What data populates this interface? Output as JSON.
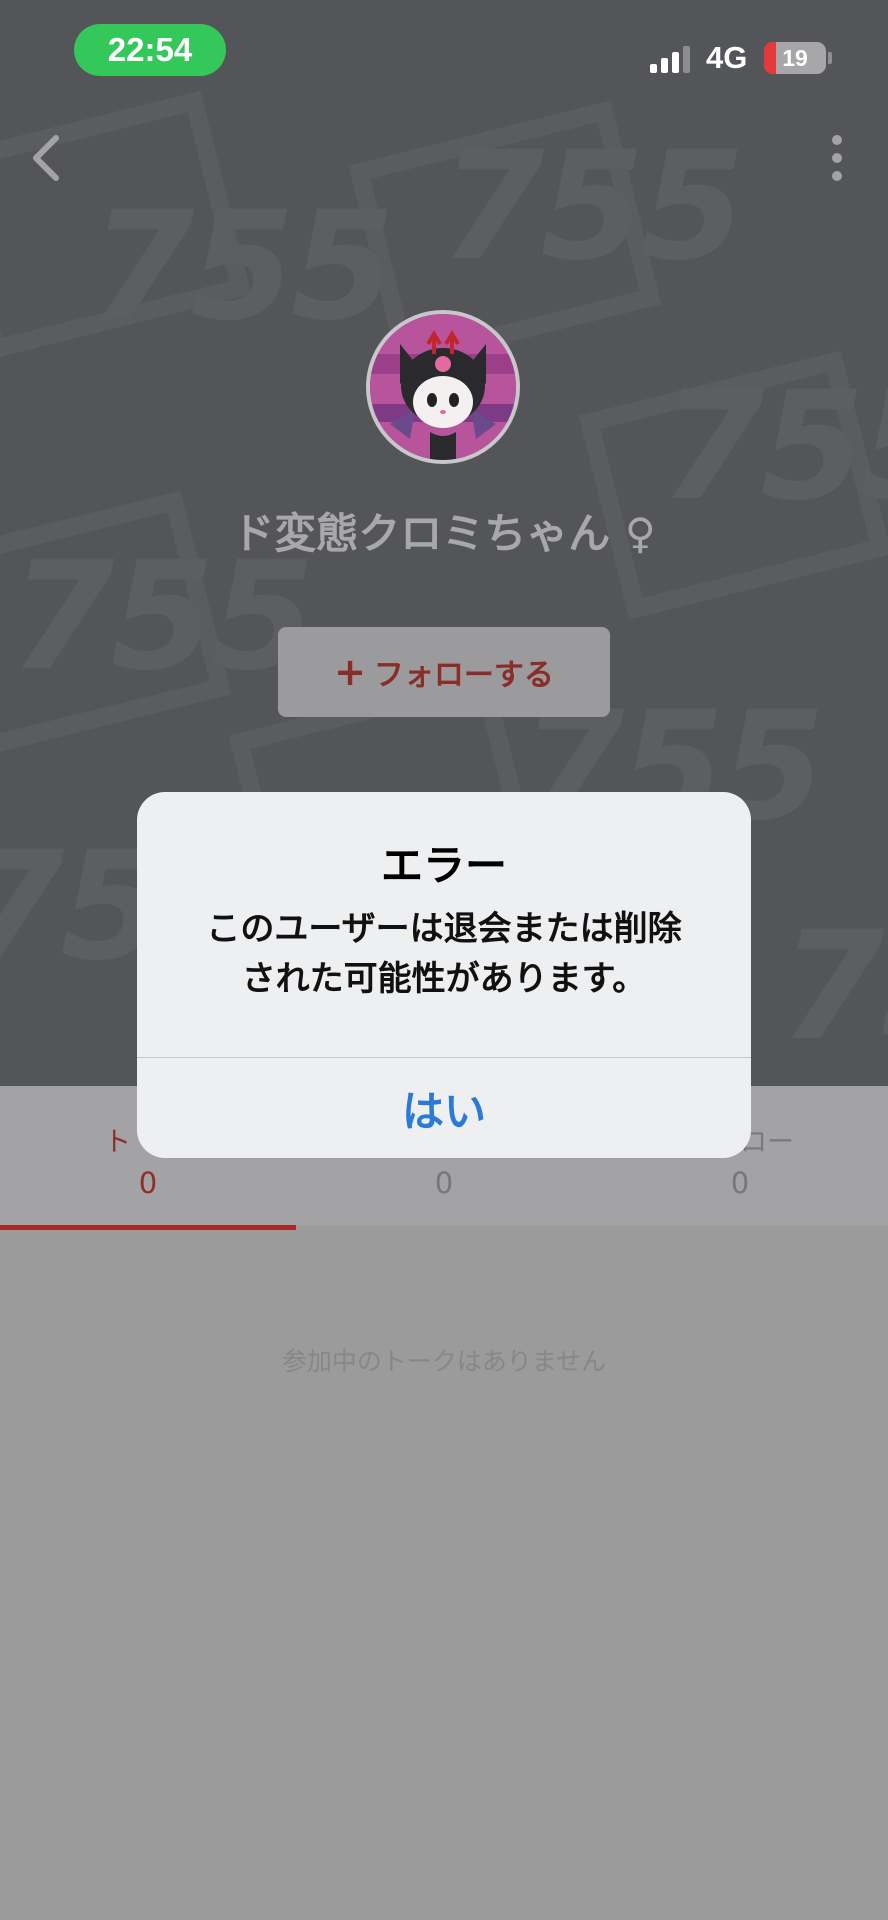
{
  "status_bar": {
    "time": "22:54",
    "network": "4G",
    "battery_level": "19",
    "colors": {
      "time_pill": "#34c759",
      "battery_low": "#e5383b"
    }
  },
  "nav": {
    "back_icon": "chevron-left-icon",
    "more_icon": "vertical-ellipsis-icon"
  },
  "profile": {
    "background_watermark": "755",
    "avatar_icon": "kuromi-avatar",
    "name": "ド変態クロミちゃん ♀",
    "follow_plus": "+",
    "follow_label": "フォローする"
  },
  "tabs": [
    {
      "label": "ト",
      "count": "0",
      "active": true
    },
    {
      "label": "",
      "count": "0",
      "active": false
    },
    {
      "label": "ロー",
      "count": "0",
      "active": false
    }
  ],
  "empty_message": "参加中のトークはありません",
  "dialog": {
    "title": "エラー",
    "message_line1": "このユーザーは退会または削除",
    "message_line2": "された可能性があります。",
    "ok_label": "はい",
    "colors": {
      "ok": "#2b7ad6",
      "accent": "#a22b26"
    }
  }
}
